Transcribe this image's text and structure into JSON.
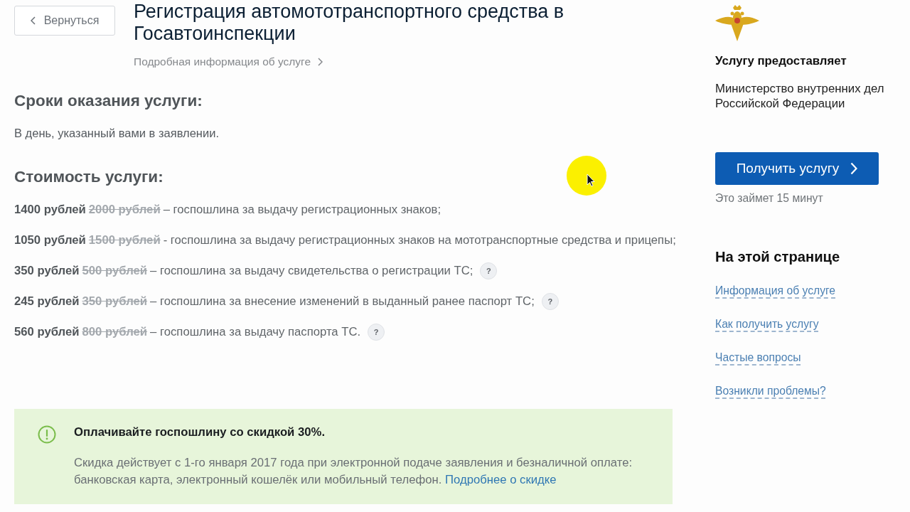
{
  "back_button": {
    "label": "Вернуться"
  },
  "header": {
    "title": "Регистрация автомототранспортного средства в Госавтоинспекции",
    "details_link": "Подробная информация об услуге"
  },
  "sections": [
    {
      "kind": "text",
      "heading": "Сроки оказания услуги:",
      "text": "В день, указанный вами в заявлении."
    },
    {
      "kind": "prices",
      "heading": "Стоимость услуги:",
      "rows": [
        {
          "price": "1400 рублей",
          "old_price": "2000 рублей",
          "description": "– госпошлина за выдачу регистрационных знаков;"
        },
        {
          "price": "1050 рублей",
          "old_price": "1500 рублей",
          "description": "- госпошлина за выдачу регистрационных знаков на мототранспортные средства и прицепы;"
        },
        {
          "price": "350 рублей",
          "old_price": "500 рублей",
          "description": "– госпошлина за выдачу свидетельства о регистрации ТС;",
          "help": "?"
        },
        {
          "price": "245 рублей",
          "old_price": "350 рублей",
          "description": "– госпошлина за внесение изменений в выданный ранее паспорт ТС;",
          "help": "?"
        },
        {
          "price": "560 рублей",
          "old_price": "800 рублей",
          "description": "– госпошлина за выдачу паспорта ТС.",
          "help": "?"
        }
      ]
    }
  ],
  "notice": {
    "title": "Оплачивайте госпошлину со скидкой 30%.",
    "text": "Скидка действует с 1-го января 2017 года при электронной подаче заявления и безналичной оплате: банковская карта, электронный кошелёк или мобильный телефон.",
    "link": "Подробнее о скидке"
  },
  "sidebar": {
    "provider_heading": "Услугу предоставляет",
    "provider": "Министерство внутренних дел Российской Федерации",
    "action_button": "Получить услугу",
    "duration": "Это займет 15 минут",
    "toc_heading": "На этой странице",
    "toc_links": [
      "Информация об услуге",
      "Как получить услугу",
      "Частые вопросы",
      "Возникли проблемы?"
    ]
  }
}
